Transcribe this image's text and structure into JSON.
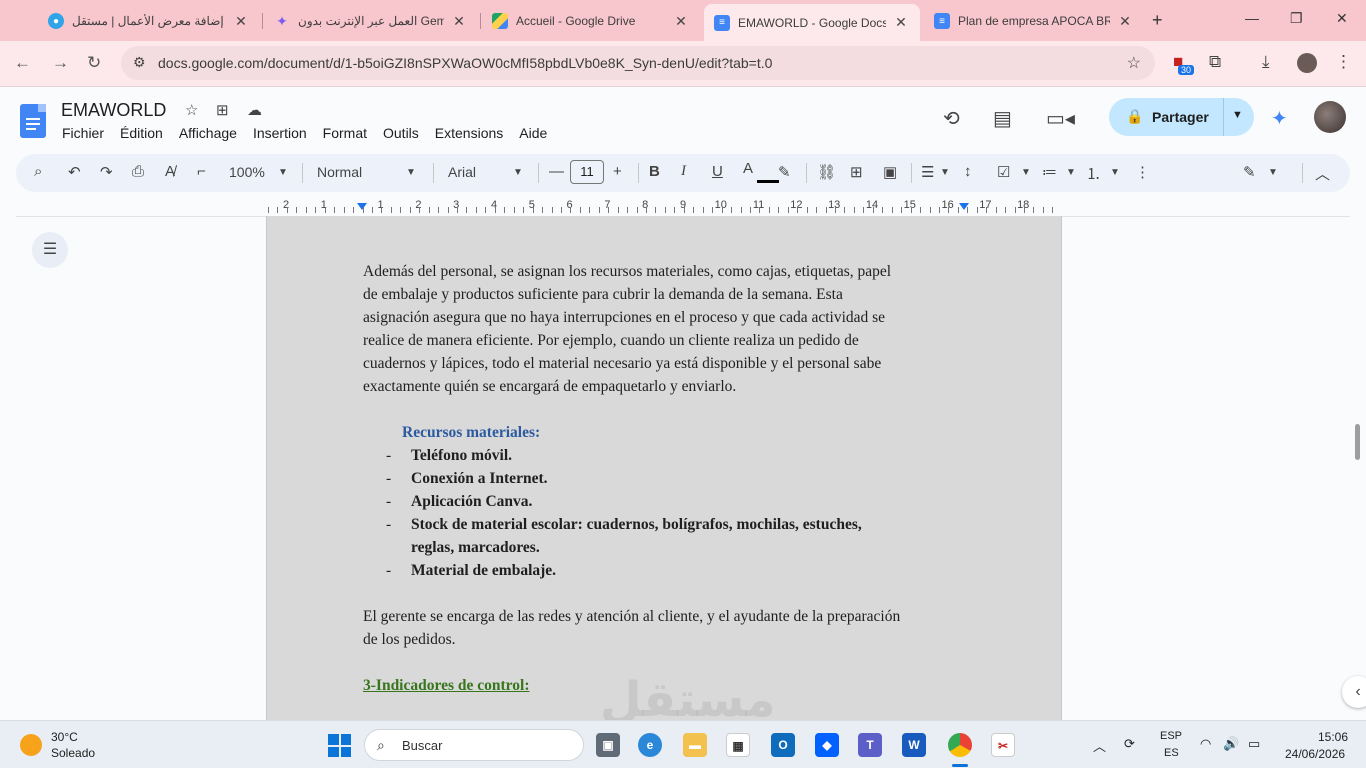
{
  "browser": {
    "tabs": [
      {
        "title": "إضافة معرض الأعمال | مستقل",
        "icon": "mostaql-icon",
        "color": "#2fa4e7"
      },
      {
        "title": "العمل عبر الإنترنت بدون Gemini",
        "icon": "gemini-icon",
        "color": "#7b5cf0"
      },
      {
        "title": "Accueil - Google Drive",
        "icon": "drive-icon",
        "color": "#1fa463"
      },
      {
        "title": "EMAWORLD - Google Docs",
        "icon": "docs-icon",
        "color": "#4285f4"
      },
      {
        "title": "Plan de empresa APOCA BRAS",
        "icon": "docs-icon",
        "color": "#4285f4"
      }
    ],
    "new_tab": "+",
    "url": "docs.google.com/document/d/1-b5oiGZI8nSPXWaOW0cMfI58pbdLVb0e8K_Syn-denU/edit?tab=t.0",
    "extension_badge": "30"
  },
  "docs": {
    "title": "EMAWORLD",
    "menu": [
      "Fichier",
      "Édition",
      "Affichage",
      "Insertion",
      "Format",
      "Outils",
      "Extensions",
      "Aide"
    ],
    "share_label": "Partager",
    "toolbar": {
      "zoom": "100%",
      "style": "Normal",
      "font": "Arial",
      "font_size": "11"
    },
    "ruler_numbers": [
      "2",
      "1",
      "1",
      "2",
      "3",
      "4",
      "5",
      "6",
      "7",
      "8",
      "9",
      "10",
      "11",
      "12",
      "13",
      "14",
      "15",
      "16",
      "17",
      "18"
    ]
  },
  "document": {
    "paragraph1": [
      "Además del personal, se asignan los recursos materiales, como cajas, etiquetas, papel",
      "de embalaje y productos suficiente para cubrir la demanda de la semana. Esta",
      "asignación asegura que no haya interrupciones en el proceso y que cada actividad se",
      "realice de manera eficiente. Por ejemplo, cuando un cliente realiza un pedido de",
      "cuadernos y lápices, todo el material necesario ya está disponible y el personal sabe",
      "exactamente quién se encargará de empaquetarlo y enviarlo."
    ],
    "materials_heading": "Recursos materiales:",
    "materials": [
      "Teléfono móvil.",
      "Conexión a Internet.",
      "Aplicación Canva.",
      "Stock de material escolar: cuadernos, bolígrafos, mochilas, estuches,",
      "reglas, marcadores.",
      "Material de embalaje."
    ],
    "bullet": "-",
    "paragraph2": [
      "El gerente se encarga de las redes y atención al cliente, y el ayudante de la preparación",
      "de los pedidos."
    ],
    "section_heading": "3-Indicadores de control:"
  },
  "watermark": "مستقل",
  "taskbar": {
    "temperature": "30°C",
    "weather": "Soleado",
    "search_label": "Buscar",
    "lang_top": "ESP",
    "lang_bottom": "ES",
    "time": "15:06",
    "date": "24/06/2026"
  }
}
